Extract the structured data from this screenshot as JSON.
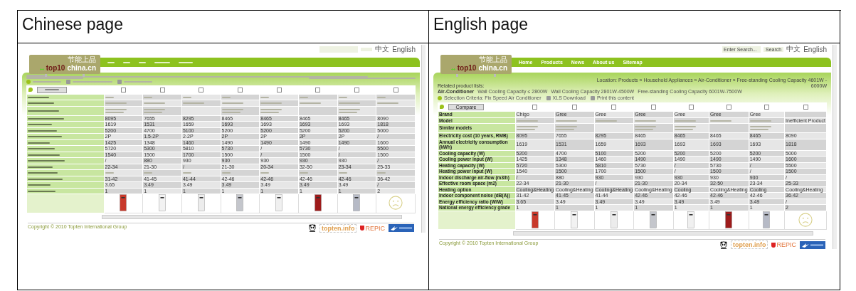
{
  "header": [
    "Chinese page",
    "English page"
  ],
  "pages": [
    {
      "lang_links": [
        "中文",
        "English"
      ],
      "logo": {
        "tagline": "节能上品",
        "brand": "top10",
        "domain": "china.cn"
      },
      "products": [
        {
          "kind": "unit",
          "color": "#c8392b",
          "checked": false
        },
        {
          "kind": "unit",
          "color": "#f2f2f2",
          "checked": false
        },
        {
          "kind": "unit",
          "color": "#ececec",
          "checked": false
        },
        {
          "kind": "unit",
          "color": "#c4c6cc",
          "checked": false
        },
        {
          "kind": "unit",
          "color": "#f0f0f0",
          "checked": false
        },
        {
          "kind": "unit",
          "color": "#9e1b1b",
          "checked": false
        },
        {
          "kind": "unit",
          "color": "#b6bac6",
          "checked": false
        },
        {
          "kind": "none",
          "checked": false
        }
      ],
      "rows": [
        {
          "kind": "blurred"
        },
        {
          "kind": "model"
        },
        {
          "kind": "similar"
        },
        {
          "kind": "values",
          "cells": [
            "8095",
            "7655",
            "8295",
            "8465",
            "8465",
            "8465",
            "8465",
            "8090"
          ]
        },
        {
          "kind": "values",
          "cells": [
            "1619",
            "1531",
            "1659",
            "1693",
            "1693",
            "1693",
            "1693",
            "1818"
          ]
        },
        {
          "kind": "values",
          "cells": [
            "5200",
            "4700",
            "5100",
            "5200",
            "5200",
            "5200",
            "5200",
            "5000"
          ]
        },
        {
          "kind": "values",
          "cells": [
            "2P",
            "1.5-2P",
            "2-2P",
            "2P",
            "2P",
            "2P",
            "2P",
            "/"
          ]
        },
        {
          "kind": "values",
          "cells": [
            "1425",
            "1348",
            "1460",
            "1490",
            "1490",
            "1490",
            "1490",
            "1600"
          ]
        },
        {
          "kind": "values",
          "cells": [
            "5720",
            "5300",
            "5810",
            "5730",
            "/",
            "5730",
            "/",
            "5500"
          ]
        },
        {
          "kind": "values",
          "cells": [
            "1540",
            "1500",
            "1700",
            "1500",
            "/",
            "1500",
            "/",
            "1500"
          ]
        },
        {
          "kind": "values",
          "cells": [
            "/",
            "880",
            "930",
            "930",
            "930",
            "930",
            "930",
            "/"
          ]
        },
        {
          "kind": "values",
          "cells": [
            "22-34",
            "21-30",
            "/",
            "21-30",
            "20-34",
            "32-50",
            "23-34",
            "25-33"
          ]
        },
        {
          "kind": "blurred"
        },
        {
          "kind": "values",
          "cells": [
            "31-42",
            "41-45",
            "41-44",
            "42-46",
            "42-46",
            "42-46",
            "42-46",
            "36-42"
          ]
        },
        {
          "kind": "values",
          "cells": [
            "3.65",
            "3.49",
            "3.49",
            "3.49",
            "3.49",
            "3.49",
            "3.49",
            "/"
          ]
        },
        {
          "kind": "values",
          "cells": [
            "1",
            "1",
            "1",
            "1",
            "1",
            "1",
            "1",
            "2"
          ]
        }
      ],
      "copyright": "Copyright © 2010 Topten International Group",
      "partners": {
        "topten": "topten.info",
        "repic": "REPIC"
      }
    },
    {
      "lang_links": [
        "中文",
        "English"
      ],
      "search": {
        "placeholder": "Enter Search...",
        "button": "Search"
      },
      "logo": {
        "tagline": "节能上品",
        "brand": "top10",
        "domain": "china.cn"
      },
      "nav": [
        "Home",
        "Products",
        "News",
        "About us",
        "Sitemap"
      ],
      "location": "Location: Products » Household Appliances » Air-Conditioner » Free-standing Cooling Capacity 4601W - 6000W",
      "related": {
        "title": "Related product lists:",
        "category": "Air-Conditioner",
        "links": [
          "Wall Cooling Capacity ≤ 2800W",
          "Wall Cooling Capacity 2801W-4500W",
          "Free-standing Cooling Capacity 6001W-7500W"
        ]
      },
      "tools": [
        "Selection Criteria: Fix Speed Air Conditioner",
        "XLS Download",
        "Print this content"
      ],
      "compare": "Compare",
      "products": [
        {
          "kind": "unit",
          "color": "#c8392b",
          "checked": false
        },
        {
          "kind": "unit",
          "color": "#f2f2f2",
          "checked": false
        },
        {
          "kind": "unit",
          "color": "#ececec",
          "checked": false
        },
        {
          "kind": "unit",
          "color": "#c4c6cc",
          "checked": false
        },
        {
          "kind": "unit",
          "color": "#f0f0f0",
          "checked": false
        },
        {
          "kind": "unit",
          "color": "#9e1b1b",
          "checked": false
        },
        {
          "kind": "unit",
          "color": "#b6bac6",
          "checked": false
        },
        {
          "kind": "none",
          "checked": false,
          "note": "Inefficient Product"
        }
      ],
      "rows": [
        {
          "kind": "values",
          "label": "Brand",
          "cells": [
            "Chigo",
            "Gree",
            "Gree",
            "Gree",
            "Gree",
            "Gree",
            "Gree"
          ]
        },
        {
          "kind": "model",
          "label": "Model"
        },
        {
          "kind": "similar",
          "label": "Similar models"
        },
        {
          "kind": "values",
          "label": "Electricity cost (10 years, RMB)",
          "cells": [
            "8095",
            "7655",
            "8295",
            "8465",
            "8465",
            "8465",
            "8465",
            "8090"
          ]
        },
        {
          "kind": "values",
          "label": "Annual electricity consumption (kWh)",
          "cells": [
            "1619",
            "1531",
            "1659",
            "1693",
            "1693",
            "1693",
            "1693",
            "1818"
          ]
        },
        {
          "kind": "values",
          "label": "Cooling capacity (W)",
          "cells": [
            "5200",
            "4700",
            "5100",
            "5200",
            "5200",
            "5200",
            "5200",
            "5000"
          ]
        },
        {
          "kind": "values",
          "label": "Cooling power input (W)",
          "cells": [
            "1425",
            "1348",
            "1460",
            "1490",
            "1490",
            "1490",
            "1490",
            "1600"
          ]
        },
        {
          "kind": "values",
          "label": "Heating capacity (W)",
          "cells": [
            "5720",
            "5300",
            "5810",
            "5730",
            "/",
            "5730",
            "/",
            "5500"
          ]
        },
        {
          "kind": "values",
          "label": "Heating power input (W)",
          "cells": [
            "1540",
            "1500",
            "1700",
            "1500",
            "/",
            "1500",
            "/",
            "1500"
          ]
        },
        {
          "kind": "values",
          "label": "Indoor discharge air-flow (m3/h)",
          "cells": [
            "/",
            "880",
            "930",
            "930",
            "930",
            "930",
            "930",
            "/"
          ]
        },
        {
          "kind": "values",
          "label": "Effective room space (m2)",
          "cells": [
            "22-34",
            "21-30",
            "/",
            "21-30",
            "20-34",
            "32-50",
            "23-34",
            "25-33"
          ]
        },
        {
          "kind": "values",
          "label": "Heating option",
          "cells": [
            "Cooling&Heating",
            "Cooling&Heating",
            "Cooling&Heating",
            "Cooling&Heating",
            "Cooling",
            "Cooling&Heating",
            "Cooling",
            "Cooling&Heating"
          ]
        },
        {
          "kind": "values",
          "label": "Indoor component noise (dB(A))",
          "cells": [
            "31-42",
            "41-45",
            "41-44",
            "42-46",
            "42-46",
            "42-46",
            "42-46",
            "36-42"
          ]
        },
        {
          "kind": "values",
          "label": "Energy efficiency ratio (W/W)",
          "cells": [
            "3.65",
            "3.49",
            "3.49",
            "3.49",
            "3.49",
            "3.49",
            "3.49",
            "/"
          ]
        },
        {
          "kind": "values",
          "label": "National energy efficiency grade",
          "cells": [
            "1",
            "1",
            "1",
            "1",
            "1",
            "1",
            "1",
            "2"
          ]
        }
      ],
      "copyright": "Copyright © 2010 Topten International Group",
      "partners": {
        "topten": "topten.info",
        "repic": "REPIC"
      }
    }
  ]
}
